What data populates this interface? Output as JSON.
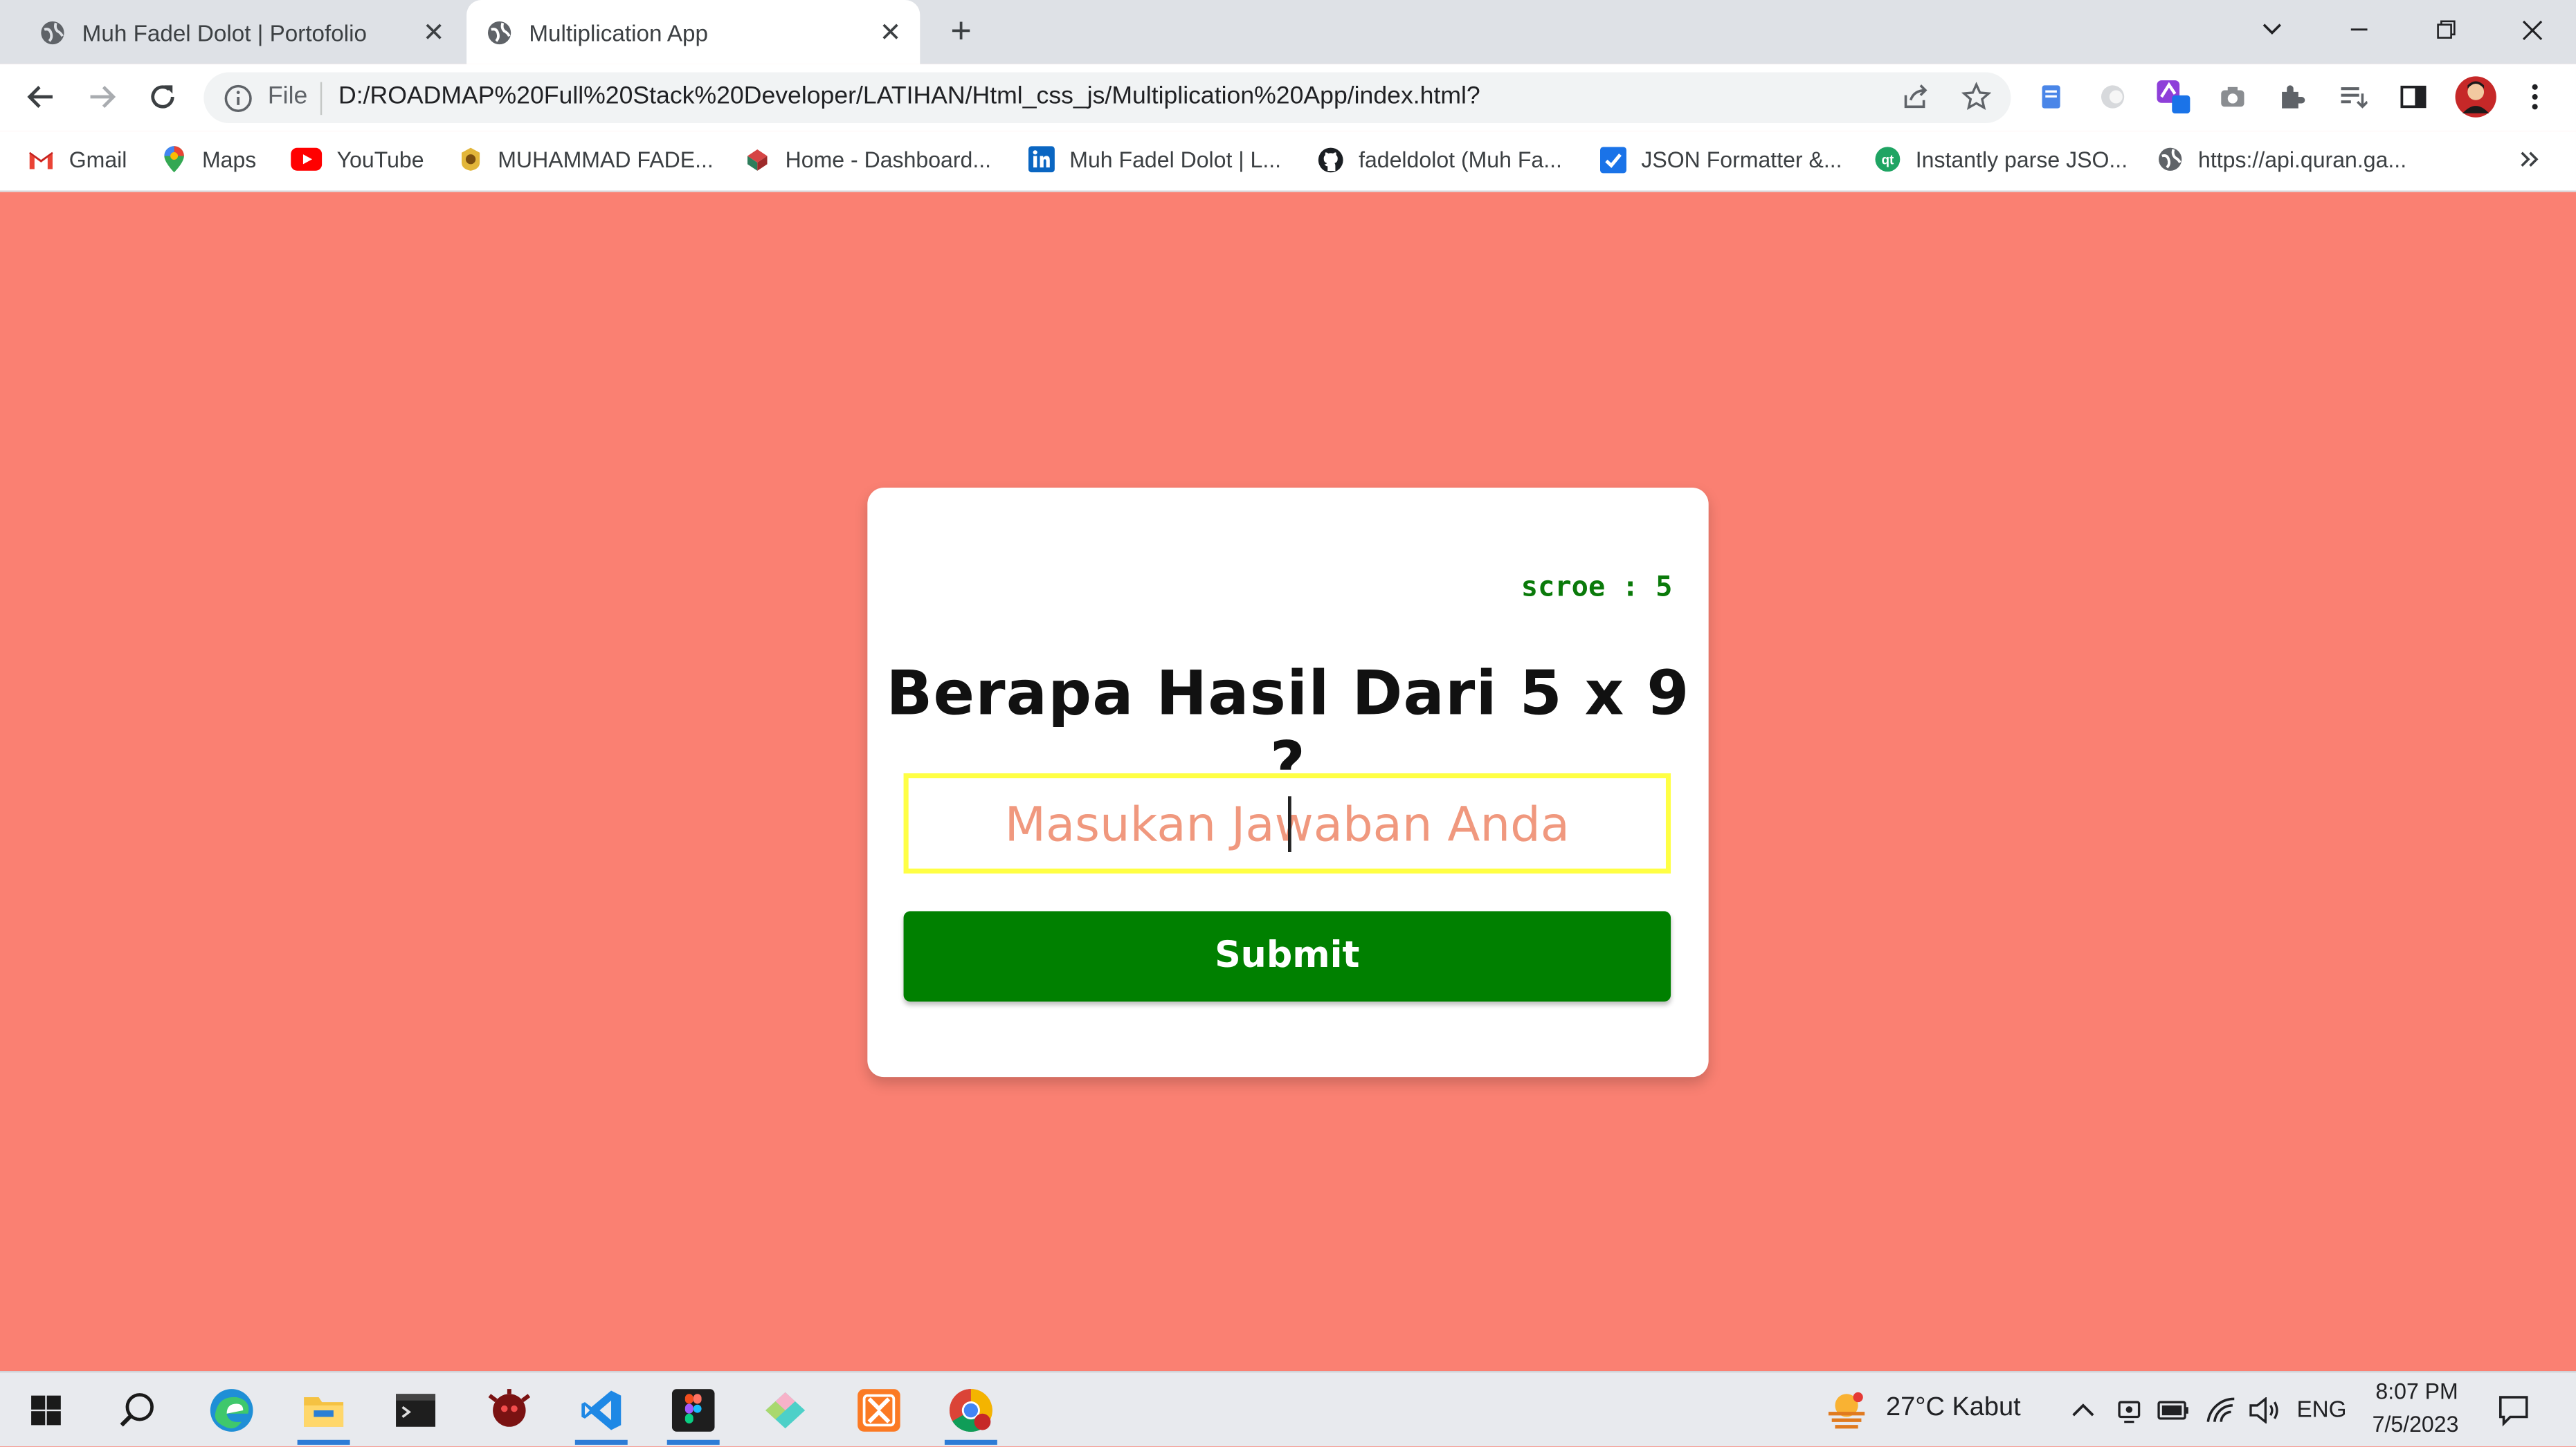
{
  "browser": {
    "tabs": [
      {
        "title": "Muh Fadel Dolot | Portofolio",
        "active": false,
        "favicon": "globe-icon"
      },
      {
        "title": "Multiplication App",
        "active": true,
        "favicon": "globe-icon"
      }
    ],
    "address": {
      "scheme_label": "File",
      "url": "D:/ROADMAP%20Full%20Stack%20Developer/LATIHAN/Html_css_js/Multiplication%20App/index.html?"
    },
    "bookmarks": [
      {
        "label": "Gmail",
        "icon": "gmail-icon"
      },
      {
        "label": "Maps",
        "icon": "maps-icon"
      },
      {
        "label": "YouTube",
        "icon": "youtube-icon"
      },
      {
        "label": "MUHAMMAD FADE...",
        "icon": "badge-icon"
      },
      {
        "label": "Home - Dashboard...",
        "icon": "dashboard-icon"
      },
      {
        "label": "Muh Fadel Dolot | L...",
        "icon": "linkedin-icon"
      },
      {
        "label": "fadeldolot (Muh Fa...",
        "icon": "github-icon"
      },
      {
        "label": "JSON Formatter &...",
        "icon": "check-icon"
      },
      {
        "label": "Instantly parse JSO...",
        "icon": "qt-icon"
      },
      {
        "label": "https://api.quran.ga...",
        "icon": "globe-icon"
      }
    ]
  },
  "app": {
    "score_text": "scroe : 5",
    "question": "Berapa Hasil Dari 5 x 9 ?",
    "answer_placeholder": "Masukan Jawaban Anda",
    "answer_value": "",
    "submit_label": "Submit"
  },
  "colors": {
    "page_background": "#FA8072",
    "submit_background": "#008000",
    "score_color": "#0A7A0A",
    "input_border": "#FFFF44"
  },
  "taskbar": {
    "weather": "27°C  Kabut",
    "language": "ENG",
    "time": "8:07 PM",
    "date": "7/5/2023"
  }
}
